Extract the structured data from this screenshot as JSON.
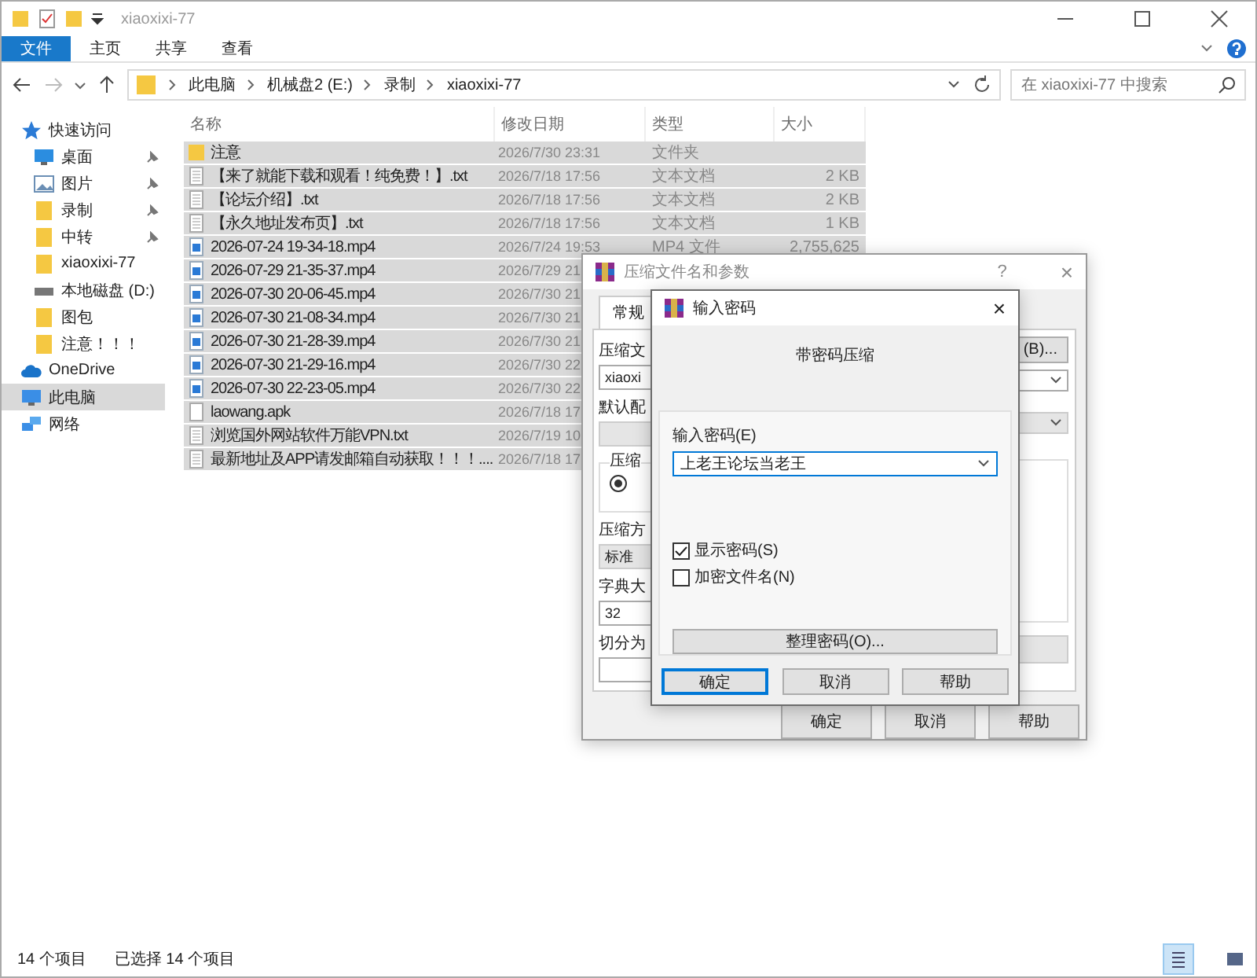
{
  "window": {
    "title": "xiaoxixi-77"
  },
  "ribbon_tabs": [
    {
      "label": "文件",
      "selected": true
    },
    {
      "label": "主页",
      "selected": false
    },
    {
      "label": "共享",
      "selected": false
    },
    {
      "label": "查看",
      "selected": false
    }
  ],
  "address": {
    "path": [
      "此电脑",
      "机械盘2 (E:)",
      "录制",
      "xiaoxixi-77"
    ]
  },
  "search": {
    "placeholder": "在 xiaoxixi-77 中搜索"
  },
  "nav": [
    {
      "label": "快速访问",
      "kind": "star",
      "selected": false,
      "children": [
        {
          "label": "桌面",
          "kind": "desktop",
          "pinned": true,
          "selected": false
        },
        {
          "label": "图片",
          "kind": "pictures",
          "pinned": true,
          "selected": false
        },
        {
          "label": "录制",
          "kind": "folder",
          "pinned": true,
          "selected": false
        },
        {
          "label": "中转",
          "kind": "folder",
          "pinned": true,
          "selected": false
        },
        {
          "label": "xiaoxixi-77",
          "kind": "folder",
          "pinned": false,
          "selected": false
        },
        {
          "label": "本地磁盘 (D:)",
          "kind": "drive",
          "pinned": false,
          "selected": false
        },
        {
          "label": "图包",
          "kind": "folder",
          "pinned": false,
          "selected": false
        },
        {
          "label": "注意！！！",
          "kind": "folder",
          "pinned": false,
          "selected": false
        }
      ]
    },
    {
      "label": "OneDrive",
      "kind": "cloud",
      "selected": false
    },
    {
      "label": "此电脑",
      "kind": "pc",
      "selected": true
    },
    {
      "label": "网络",
      "kind": "network",
      "selected": false
    }
  ],
  "table": {
    "columns": [
      "名称",
      "修改日期",
      "类型",
      "大小"
    ],
    "rows": [
      {
        "kind": "folder",
        "name": "注意",
        "date": "2026/7/30 23:31",
        "type": "文件夹",
        "selected": true
      },
      {
        "kind": "txt",
        "name": "【来了就能下载和观看！纯免费！】.txt",
        "date": "2026/7/18 17:56",
        "type": "文本文档",
        "size": "2 KB",
        "selected": true
      },
      {
        "kind": "txt",
        "name": "【论坛介绍】.txt",
        "date": "2026/7/18 17:56",
        "type": "文本文档",
        "size": "2 KB",
        "selected": true
      },
      {
        "kind": "txt",
        "name": "【永久地址发布页】.txt",
        "date": "2026/7/18 17:56",
        "type": "文本文档",
        "size": "1 KB",
        "selected": true
      },
      {
        "kind": "video",
        "name": "2026-07-24 19-34-18.mp4",
        "date": "2026/7/24 19:53",
        "type": "MP4 文件",
        "size": "2,755,625",
        "selected": true
      },
      {
        "kind": "video",
        "name": "2026-07-29 21-35-37.mp4",
        "date": "2026/7/29 21",
        "selected": true
      },
      {
        "kind": "video",
        "name": "2026-07-30 20-06-45.mp4",
        "date": "2026/7/30 21",
        "selected": true
      },
      {
        "kind": "video",
        "name": "2026-07-30 21-08-34.mp4",
        "date": "2026/7/30 21",
        "selected": true
      },
      {
        "kind": "video",
        "name": "2026-07-30 21-28-39.mp4",
        "date": "2026/7/30 21",
        "selected": true
      },
      {
        "kind": "video",
        "name": "2026-07-30 21-29-16.mp4",
        "date": "2026/7/30 22",
        "selected": true
      },
      {
        "kind": "video",
        "name": "2026-07-30 22-23-05.mp4",
        "date": "2026/7/30 22",
        "selected": true
      },
      {
        "kind": "file",
        "name": "laowang.apk",
        "date": "2026/7/18 17",
        "selected": true
      },
      {
        "kind": "txt",
        "name": "浏览国外网站软件万能VPN.txt",
        "date": "2026/7/19 10",
        "selected": true
      },
      {
        "kind": "txt",
        "name": "最新地址及APP请发邮箱自动获取！！！....",
        "date": "2026/7/18 17",
        "selected": true
      }
    ]
  },
  "status_bar": {
    "count": "14 个项目",
    "selection": "已选择 14 个项目"
  },
  "archive_dialog": {
    "title": "压缩文件名和参数",
    "help": "?",
    "close": "×",
    "tab": "常规",
    "labels": [
      "压缩文",
      "默认配",
      "压缩",
      "压缩方",
      "字典大",
      "切分为"
    ],
    "archive_name": "xiaoxi",
    "option_selected": true,
    "method": "标准",
    "dictionary": "32",
    "browse_button": "(B)...",
    "buttons": [
      "确定",
      "取消",
      "帮助"
    ]
  },
  "password_dialog": {
    "title": "输入密码",
    "close": "×",
    "heading": "带密码压缩",
    "field_label": "输入密码(E)",
    "value": "上老王论坛当老王",
    "checkboxes": [
      {
        "label": "显示密码(S)",
        "checked": true
      },
      {
        "label": "加密文件名(N)",
        "checked": false
      }
    ],
    "manage_button": "整理密码(O)...",
    "buttons": [
      {
        "label": "确定",
        "default": true
      },
      {
        "label": "取消",
        "default": false
      },
      {
        "label": "帮助",
        "default": false
      }
    ]
  }
}
